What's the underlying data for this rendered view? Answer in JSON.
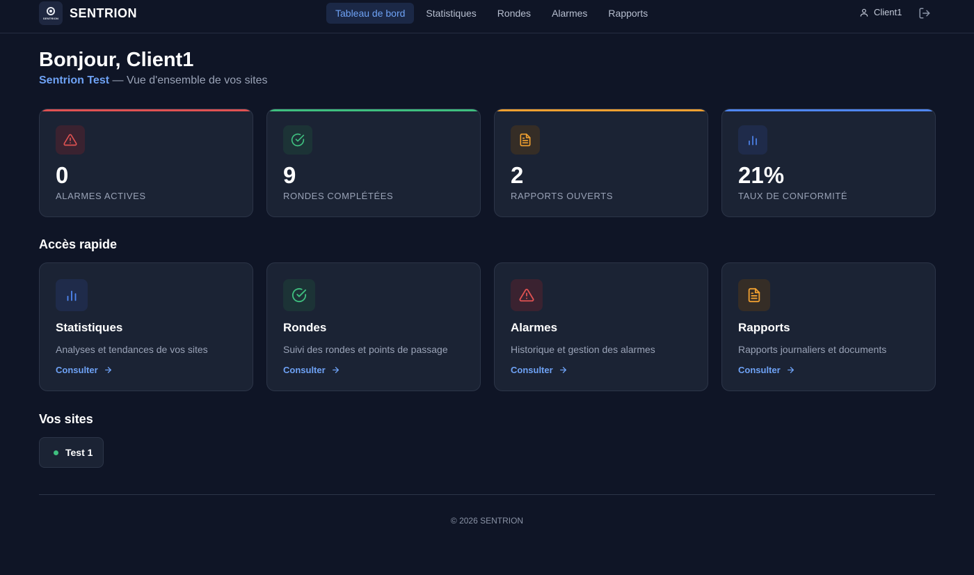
{
  "brand": {
    "name": "SENTRION",
    "logo_text": "SENTRION"
  },
  "nav": {
    "links": [
      {
        "label": "Tableau de bord",
        "active": true
      },
      {
        "label": "Statistiques",
        "active": false
      },
      {
        "label": "Rondes",
        "active": false
      },
      {
        "label": "Alarmes",
        "active": false
      },
      {
        "label": "Rapports",
        "active": false
      }
    ],
    "user": "Client1",
    "user_icon": "user-icon",
    "logout_icon": "logout-icon"
  },
  "header": {
    "greeting": "Bonjour, Client1",
    "org": "Sentrion Test",
    "subtitle": " — Vue d'ensemble de vos sites"
  },
  "stats": [
    {
      "value": "0",
      "label": "ALARMES ACTIVES",
      "icon": "warning-icon",
      "color": "#e05252"
    },
    {
      "value": "9",
      "label": "RONDES COMPLÉTÉES",
      "icon": "check-circle-icon",
      "color": "#3fbf7f"
    },
    {
      "value": "2",
      "label": "RAPPORTS OUVERTS",
      "icon": "document-icon",
      "color": "#f0a030"
    },
    {
      "value": "21%",
      "label": "TAUX DE CONFORMITÉ",
      "icon": "bar-chart-icon",
      "color": "#4f86f0"
    }
  ],
  "quick_access": {
    "title": "Accès rapide",
    "cards": [
      {
        "title": "Statistiques",
        "description": "Analyses et tendances de vos sites",
        "link": "Consulter",
        "icon": "bar-chart-icon",
        "color": "#4f86f0"
      },
      {
        "title": "Rondes",
        "description": "Suivi des rondes et points de passage",
        "link": "Consulter",
        "icon": "check-circle-icon",
        "color": "#3fbf7f"
      },
      {
        "title": "Alarmes",
        "description": "Historique et gestion des alarmes",
        "link": "Consulter",
        "icon": "warning-icon",
        "color": "#e05252"
      },
      {
        "title": "Rapports",
        "description": "Rapports journaliers et documents",
        "link": "Consulter",
        "icon": "document-icon",
        "color": "#f0a030"
      }
    ]
  },
  "sites": {
    "title": "Vos sites",
    "items": [
      {
        "name": "Test 1",
        "status_color": "#3fbf7f"
      }
    ]
  },
  "footer": {
    "copyright": "© 2026 SENTRION"
  }
}
